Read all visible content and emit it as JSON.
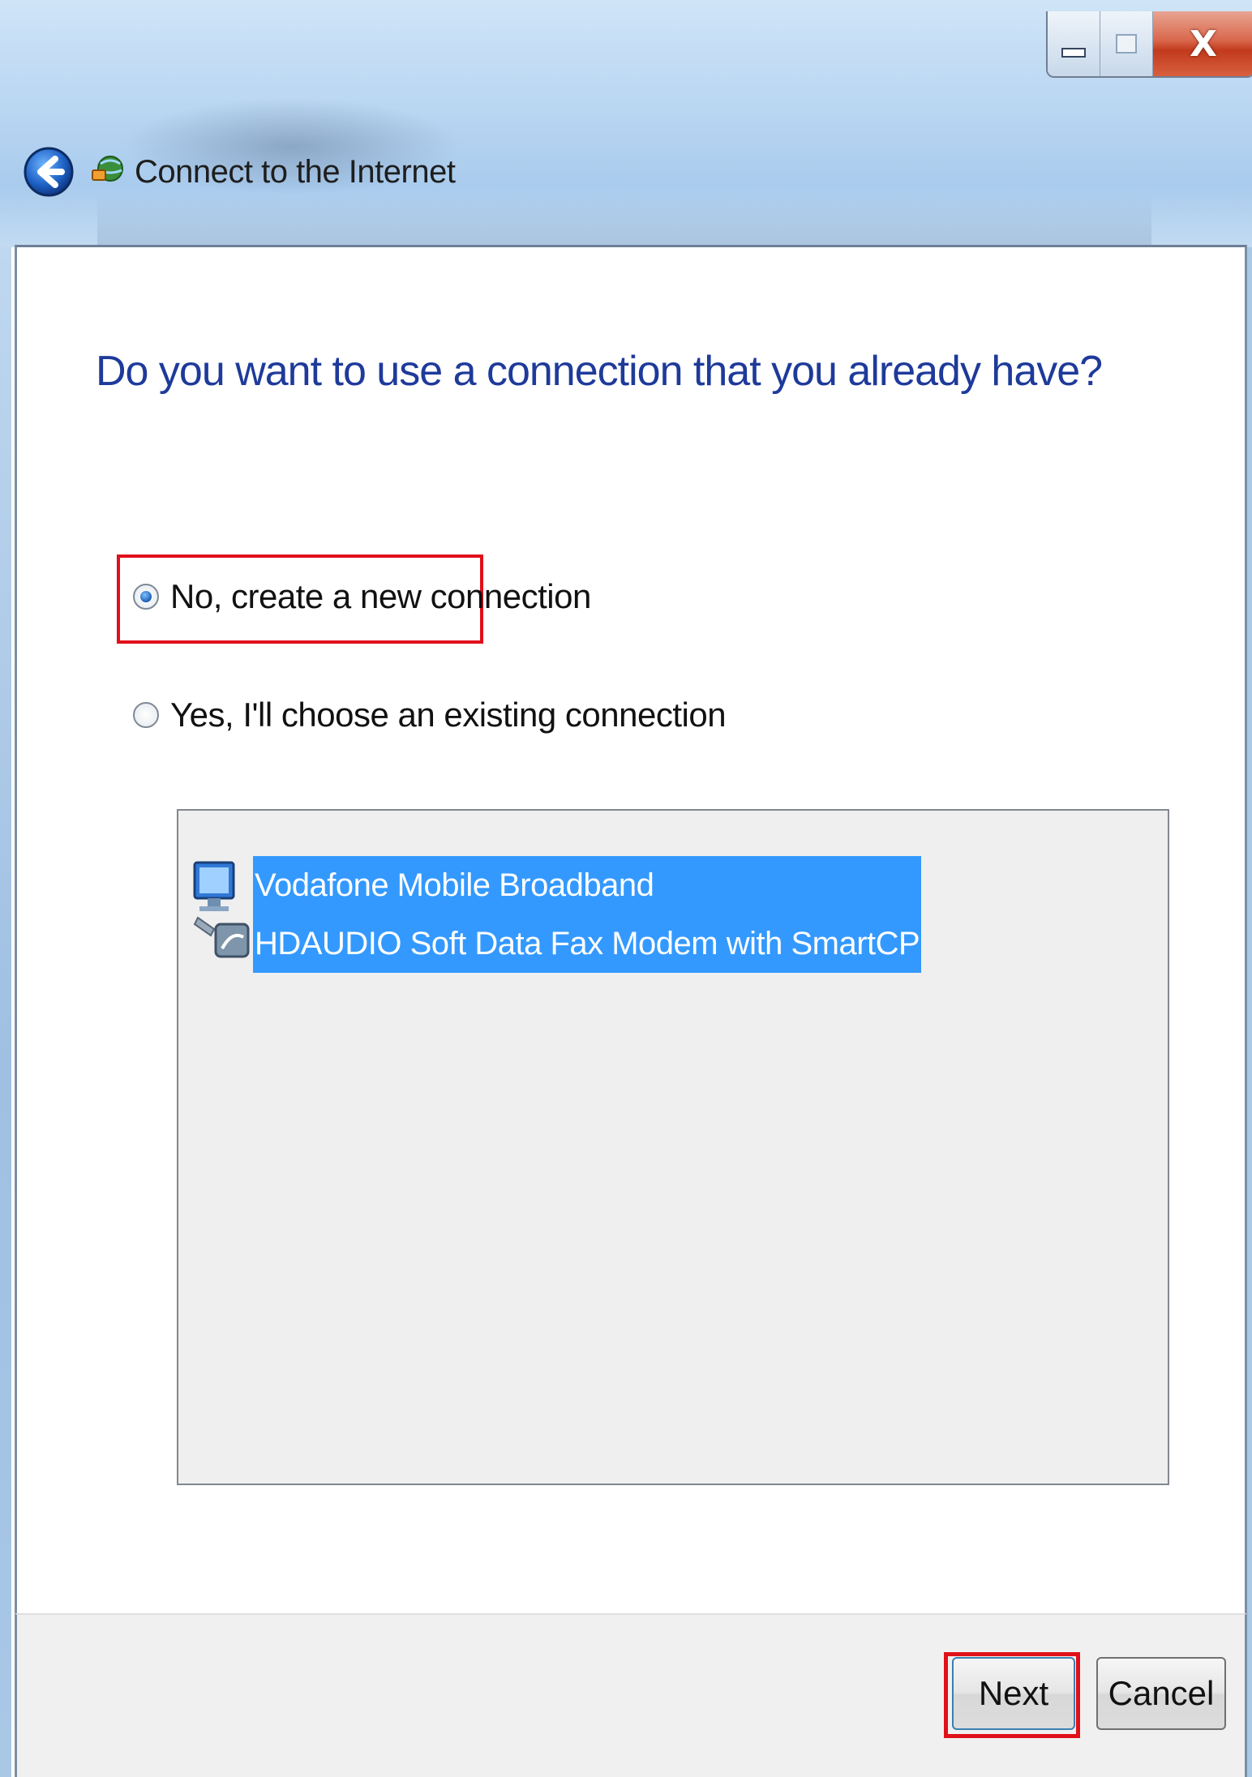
{
  "window": {
    "title": "Connect to the Internet",
    "controls": {
      "minimize": "minimize",
      "maximize": "maximize",
      "close": "X"
    }
  },
  "page": {
    "heading": "Do you want to use a connection that you already have?"
  },
  "options": [
    {
      "label": "No, create a new connection",
      "selected": true
    },
    {
      "label": "Yes, I'll choose an existing connection",
      "selected": false
    }
  ],
  "connections": [
    {
      "name": "Vodafone Mobile Broadband",
      "device": "HDAUDIO Soft Data Fax Modem with SmartCP",
      "selected": true
    }
  ],
  "buttons": {
    "next": "Next",
    "cancel": "Cancel"
  },
  "colors": {
    "heading": "#1e3a9a",
    "highlight_annotation": "#e0101a",
    "selection": "#3399ff"
  },
  "icons": {
    "back": "back-arrow-icon",
    "app": "network-globe-icon",
    "connection": "network-computer-modem-icon"
  }
}
